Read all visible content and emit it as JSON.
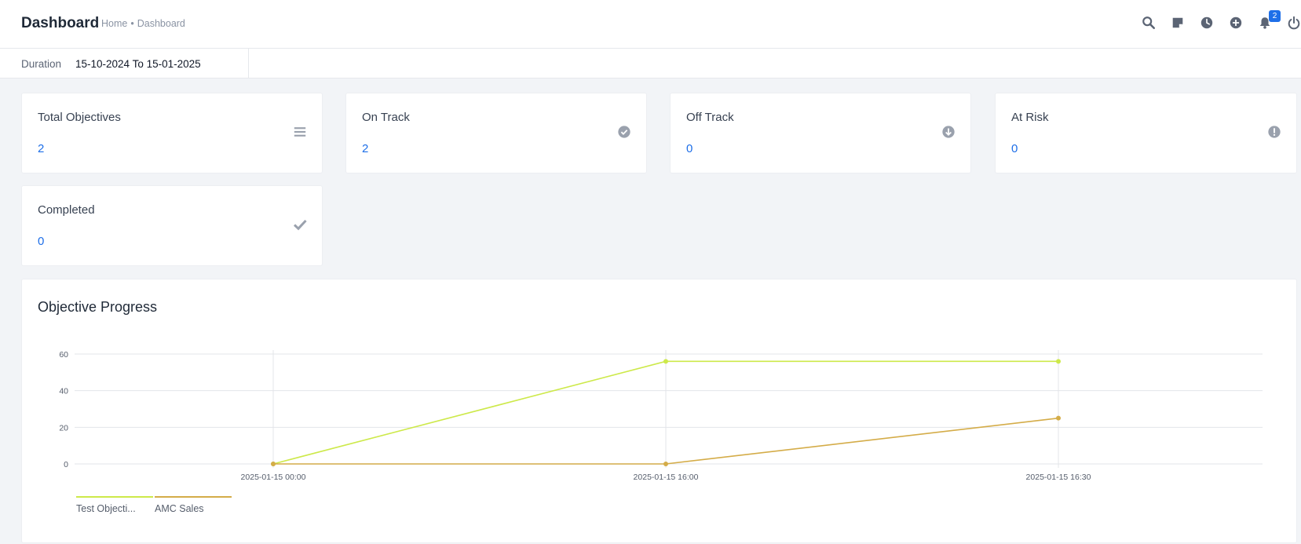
{
  "header": {
    "title": "Dashboard",
    "breadcrumb": [
      "Home",
      "Dashboard"
    ],
    "breadcrumb_separator": "•",
    "icons": [
      "search-icon",
      "sticky-note-icon",
      "clock-icon",
      "plus-circle-icon",
      "bell-icon",
      "power-icon"
    ],
    "notification_count": "2"
  },
  "filter": {
    "label": "Duration",
    "value": "15-10-2024 To 15-01-2025"
  },
  "cards": [
    {
      "label": "Total Objectives",
      "value": "2",
      "icon": "list-icon"
    },
    {
      "label": "On Track",
      "value": "2",
      "icon": "check-circle-icon"
    },
    {
      "label": "Off Track",
      "value": "0",
      "icon": "arrow-down-circle-icon"
    },
    {
      "label": "At Risk",
      "value": "0",
      "icon": "exclamation-circle-icon"
    },
    {
      "label": "Completed",
      "value": "0",
      "icon": "checkmark-icon"
    }
  ],
  "colors": {
    "accent": "#1e6fe8",
    "icon": "#5b6474",
    "card_icon": "#9aa1ad",
    "series_1": "#cde94a",
    "series_2": "#d4ac48"
  },
  "chart_panel": {
    "title": "Objective Progress"
  },
  "chart_data": {
    "type": "line",
    "title": "Objective Progress",
    "x": [
      "2025-01-15 00:00",
      "2025-01-15 16:00",
      "2025-01-15 16:30"
    ],
    "series": [
      {
        "name": "Test Objecti...",
        "values": [
          0,
          56,
          56
        ]
      },
      {
        "name": "AMC Sales",
        "values": [
          0,
          0,
          25
        ]
      }
    ],
    "yticks": [
      0,
      20,
      40,
      60
    ],
    "ylim": [
      0,
      60
    ],
    "grid": true,
    "legend": "bottom-left",
    "xlabel": "",
    "ylabel": ""
  }
}
